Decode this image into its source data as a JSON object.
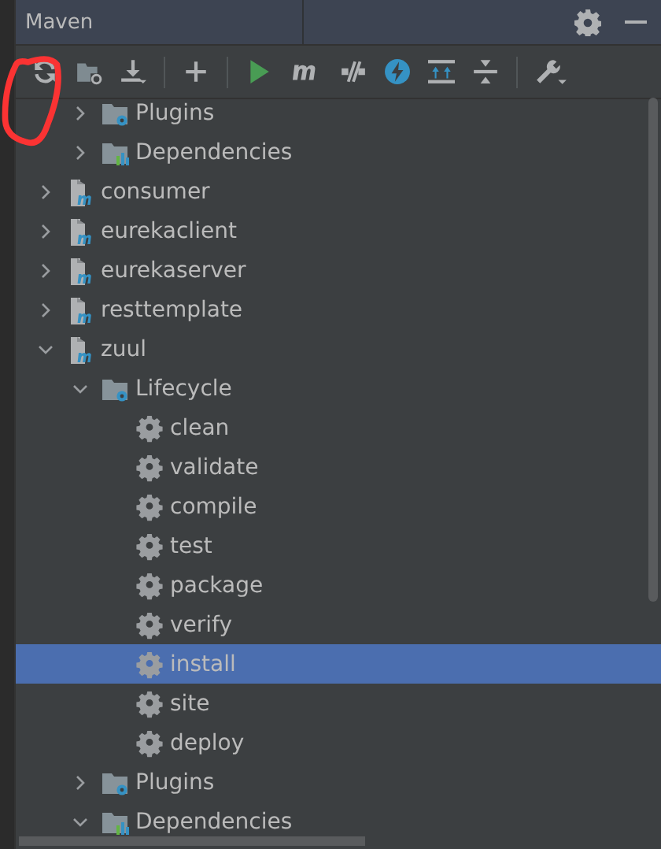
{
  "window": {
    "title": "Maven"
  },
  "tree": [
    {
      "children": [
        {
          "label": "Plugins",
          "kind": "plugins",
          "expanded": false,
          "selected": false
        },
        {
          "label": "Dependencies",
          "kind": "dependencies",
          "expanded": false,
          "selected": false
        }
      ]
    },
    {
      "label": "consumer",
      "kind": "module",
      "expanded": false,
      "selected": false
    },
    {
      "label": "eurekaclient",
      "kind": "module",
      "expanded": false,
      "selected": false
    },
    {
      "label": "eurekaserver",
      "kind": "module",
      "expanded": false,
      "selected": false
    },
    {
      "label": "resttemplate",
      "kind": "module",
      "expanded": false,
      "selected": false
    },
    {
      "label": "zuul",
      "kind": "module",
      "expanded": true,
      "selected": false,
      "children": [
        {
          "label": "Lifecycle",
          "kind": "lifecycle",
          "expanded": true,
          "selected": false,
          "children": [
            {
              "label": "clean",
              "kind": "goal",
              "selected": false
            },
            {
              "label": "validate",
              "kind": "goal",
              "selected": false
            },
            {
              "label": "compile",
              "kind": "goal",
              "selected": false
            },
            {
              "label": "test",
              "kind": "goal",
              "selected": false
            },
            {
              "label": "package",
              "kind": "goal",
              "selected": false
            },
            {
              "label": "verify",
              "kind": "goal",
              "selected": false
            },
            {
              "label": "install",
              "kind": "goal",
              "selected": true
            },
            {
              "label": "site",
              "kind": "goal",
              "selected": false
            },
            {
              "label": "deploy",
              "kind": "goal",
              "selected": false
            }
          ]
        },
        {
          "label": "Plugins",
          "kind": "plugins",
          "expanded": false,
          "selected": false
        },
        {
          "label": "Dependencies",
          "kind": "dependencies",
          "expanded": true,
          "selected": false
        }
      ]
    }
  ]
}
